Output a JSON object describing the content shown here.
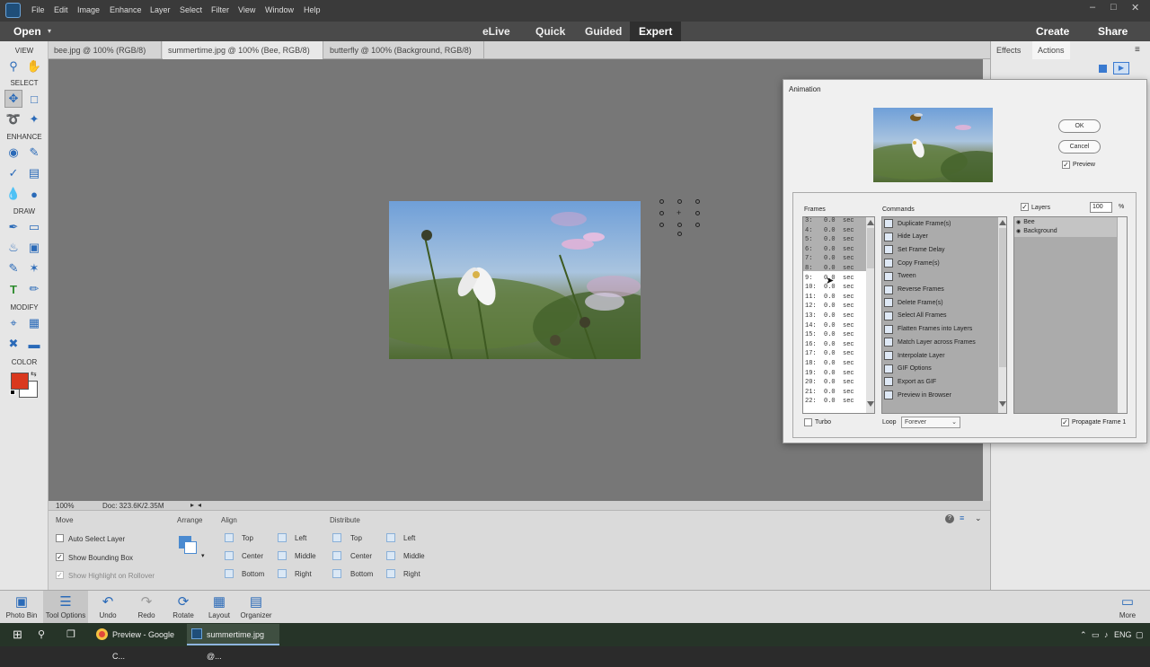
{
  "menubar": {
    "items": [
      "File",
      "Edit",
      "Image",
      "Enhance",
      "Layer",
      "Select",
      "Filter",
      "View",
      "Window",
      "Help"
    ],
    "window_controls": [
      "–",
      "□",
      "✕"
    ]
  },
  "modebar": {
    "open_label": "Open",
    "tabs": [
      "eLive",
      "Quick",
      "Guided",
      "Expert"
    ],
    "active_tab": "Expert",
    "create_label": "Create",
    "share_label": "Share"
  },
  "toolbox": {
    "sections": [
      "VIEW",
      "SELECT",
      "ENHANCE",
      "DRAW",
      "MODIFY",
      "COLOR"
    ],
    "foreground_color": "#d9381e",
    "background_color": "#ffffff"
  },
  "doctabs": [
    {
      "label": "bee.jpg @ 100% (RGB/8) *",
      "close": "×"
    },
    {
      "label": "summertime.jpg @ 100% (Bee, RGB/8) *",
      "close": "×"
    },
    {
      "label": "butterfly @ 100% (Background, RGB/8) *",
      "close": "×"
    }
  ],
  "status": {
    "zoom": "100%",
    "doc": "Doc: 323.6K/2.35M"
  },
  "options": {
    "move": "Move",
    "arrange": "Arrange",
    "align": "Align",
    "distribute": "Distribute",
    "auto_select": "Auto Select Layer",
    "show_bounding": "Show Bounding Box",
    "show_highlight": "Show Highlight on Rollover",
    "align_items": [
      "Top",
      "Center",
      "Bottom",
      "Left",
      "Middle",
      "Right"
    ],
    "distribute_items": [
      "Top",
      "Center",
      "Bottom",
      "Left",
      "Middle",
      "Right"
    ]
  },
  "rpanel": {
    "tabs": [
      "Effects",
      "Actions"
    ],
    "active": "Actions"
  },
  "appbar": {
    "buttons": [
      "Photo Bin",
      "Tool Options",
      "Undo",
      "Redo",
      "Rotate",
      "Layout",
      "Organizer"
    ],
    "more": "More"
  },
  "taskbar": {
    "apps": [
      "Preview - Google C...",
      "summertime.jpg @..."
    ],
    "lang": "ENG"
  },
  "dialog": {
    "title": "Animation",
    "ok": "OK",
    "cancel": "Cancel",
    "preview_label": "Preview",
    "frames_label": "Frames",
    "commands_label": "Commands",
    "layers_label": "Layers",
    "opacity_value": "100",
    "percent": "%",
    "turbo_label": "Turbo",
    "loop_label": "Loop",
    "loop_value": "Forever",
    "propagate_label": "Propagate Frame 1",
    "frames": [
      "3:   0.0  sec",
      "4:   0.0  sec",
      "5:   0.0  sec",
      "6:   0.0  sec",
      "7:   0.0  sec",
      "8:   0.0  sec",
      "9:   0.0  sec",
      "10:  0.0  sec",
      "11:  0.0  sec",
      "12:  0.0  sec",
      "13:  0.0  sec",
      "14:  0.0  sec",
      "15:  0.0  sec",
      "16:  0.0  sec",
      "17:  0.0  sec",
      "18:  0.0  sec",
      "19:  0.0  sec",
      "20:  0.0  sec",
      "21:  0.0  sec",
      "22:  0.0  sec"
    ],
    "commands": [
      "Duplicate Frame(s)",
      "Hide Layer",
      "Set Frame Delay",
      "Copy Frame(s)",
      "Tween",
      "Reverse Frames",
      "Delete Frame(s)",
      "Select All Frames",
      "Flatten Frames into Layers",
      "Match Layer across Frames",
      "Interpolate Layer",
      "GIF Options",
      "Export as GIF",
      "Preview in Browser"
    ],
    "layers": [
      "Bee",
      "Background"
    ]
  }
}
